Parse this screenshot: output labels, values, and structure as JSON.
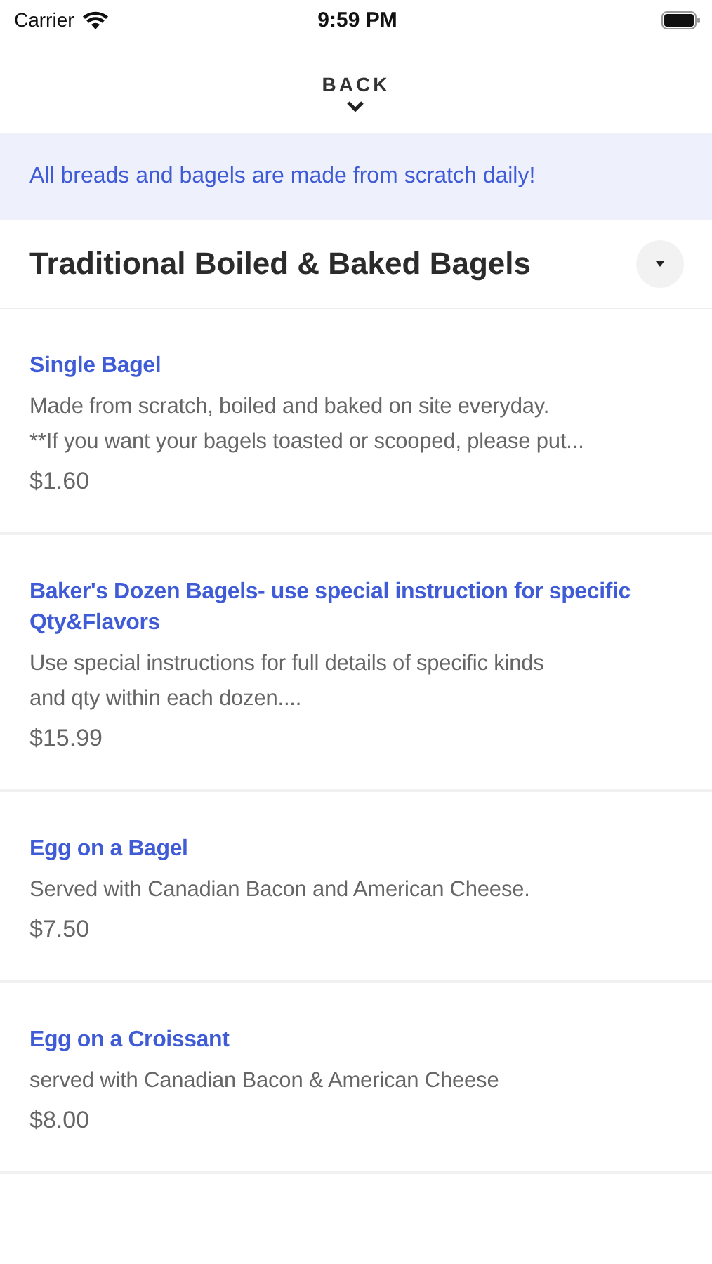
{
  "status_bar": {
    "carrier": "Carrier",
    "time": "9:59 PM"
  },
  "back": {
    "label": "BACK"
  },
  "banner": "All breads and bagels are made from scratch daily!",
  "section": {
    "title": "Traditional Boiled & Baked Bagels",
    "expanded": true
  },
  "items": [
    {
      "name_lines": [
        "Single Bagel"
      ],
      "description_lines": [
        "Made from scratch,  boiled and baked on site everyday.",
        "**If you want your bagels toasted or scooped, please put..."
      ],
      "price": "$1.60"
    },
    {
      "name_lines": [
        "Baker's Dozen Bagels- use special instruction for specific",
        "Qty&Flavors"
      ],
      "description_lines": [
        "Use special instructions for full details of specific kinds",
        "and qty within each dozen...."
      ],
      "price": "$15.99"
    },
    {
      "name_lines": [
        "Egg on a Bagel"
      ],
      "description_lines": [
        "Served with Canadian Bacon and American Cheese."
      ],
      "price": "$7.50"
    },
    {
      "name_lines": [
        "Egg on a Croissant"
      ],
      "description_lines": [
        "served with Canadian Bacon & American Cheese"
      ],
      "price": "$8.00"
    }
  ]
}
